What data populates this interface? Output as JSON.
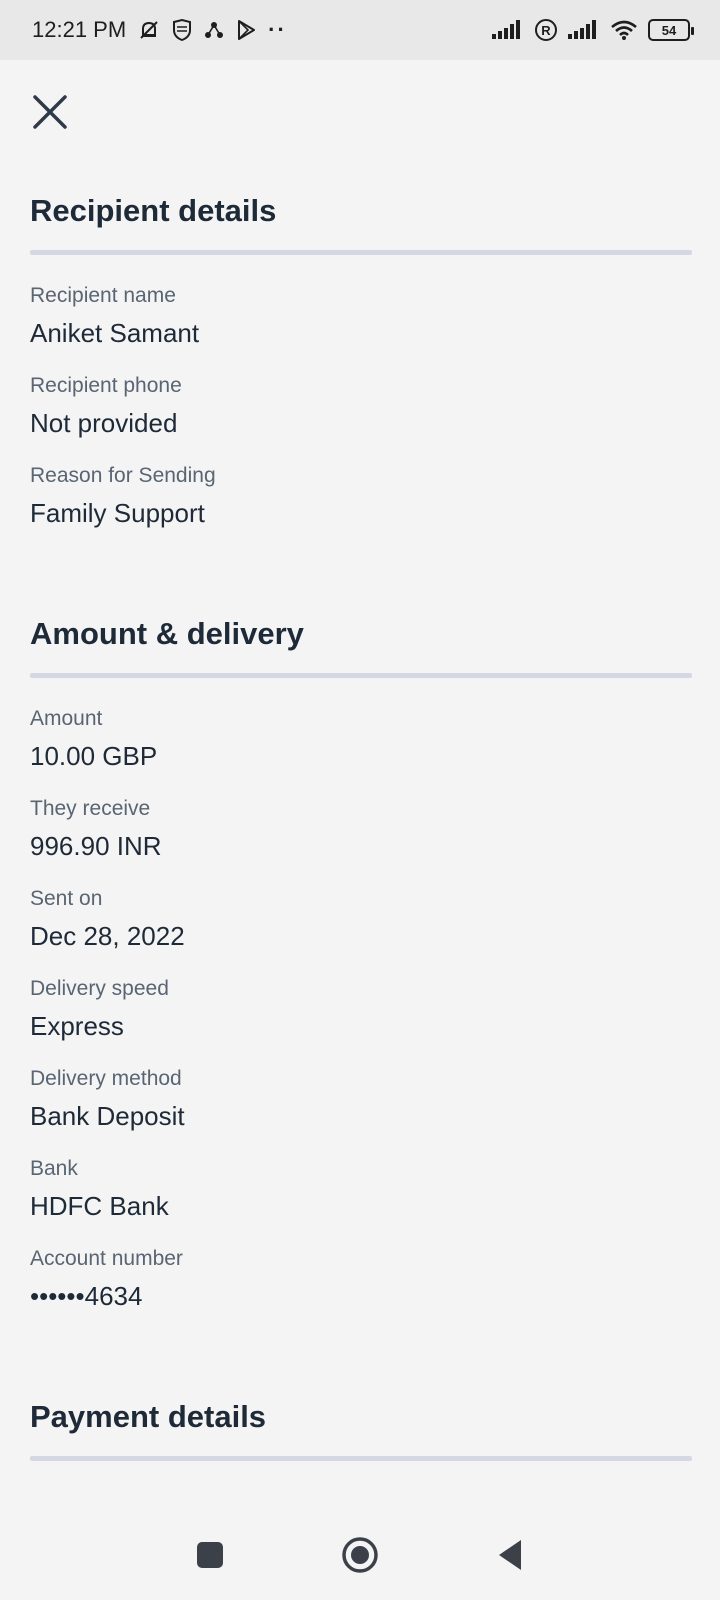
{
  "status_bar": {
    "time": "12:21 PM",
    "battery": "54",
    "icons": [
      "mute-icon",
      "shield-icon",
      "share-icon",
      "play-store-icon",
      "more-dots-icon",
      "signal-icon",
      "roaming-icon",
      "signal-icon",
      "wifi-icon",
      "battery-icon"
    ]
  },
  "header": {
    "close_icon": "close-icon"
  },
  "recipient_section": {
    "title": "Recipient details",
    "fields": [
      {
        "label": "Recipient name",
        "value": "Aniket Samant"
      },
      {
        "label": "Recipient phone",
        "value": "Not provided"
      },
      {
        "label": "Reason for Sending",
        "value": "Family Support"
      }
    ]
  },
  "amount_section": {
    "title": "Amount & delivery",
    "fields": [
      {
        "label": "Amount",
        "value": "10.00 GBP"
      },
      {
        "label": "They receive",
        "value": "996.90 INR"
      },
      {
        "label": "Sent on",
        "value": "Dec 28, 2022"
      },
      {
        "label": "Delivery speed",
        "value": "Express"
      },
      {
        "label": "Delivery method",
        "value": "Bank Deposit"
      },
      {
        "label": "Bank",
        "value": "HDFC Bank"
      },
      {
        "label": "Account number",
        "value": "••••••4634"
      }
    ]
  },
  "payment_section": {
    "title": "Payment details"
  },
  "nav_bar": {
    "icons": [
      "recents-icon",
      "home-icon",
      "back-icon"
    ]
  },
  "colors": {
    "text": "#1e2a38",
    "label": "#5a6573",
    "divider": "#d3d8e2",
    "background": "#f4f4f4"
  }
}
